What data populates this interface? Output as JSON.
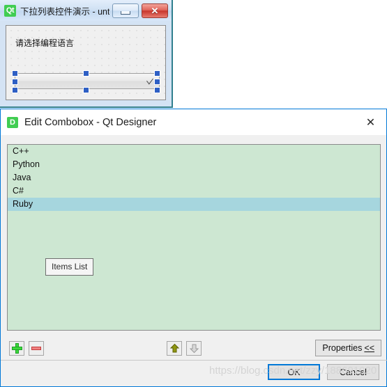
{
  "designer_form": {
    "title": "下拉列表控件演示 - unti...",
    "logo_text": "Qt",
    "logo_icon": "qt-logo-icon",
    "minimize_icon": "minimize-icon",
    "close_icon": "close-icon",
    "label_text": "请选择编程语言",
    "combobox_value": "",
    "combobox_arrow_icon": "chevron-down-icon"
  },
  "dialog": {
    "title": "Edit Combobox - Qt Designer",
    "icon_text": "D",
    "icon_name": "qt-designer-icon",
    "close_icon": "✕",
    "items": [
      {
        "label": "C++",
        "selected": false
      },
      {
        "label": "Python",
        "selected": false
      },
      {
        "label": "Java",
        "selected": false
      },
      {
        "label": "C#",
        "selected": false
      },
      {
        "label": "Ruby",
        "selected": true
      }
    ],
    "tooltip": "Items List",
    "toolbar": {
      "add_icon": "plus-icon",
      "remove_icon": "minus-icon",
      "move_up_icon": "arrow-up-icon",
      "move_down_icon": "arrow-down-icon",
      "properties_label": "Properties",
      "properties_chevrons": "<<"
    },
    "buttons": {
      "ok": "OK",
      "cancel": "Cancel"
    },
    "colors": {
      "list_background": "#cde7d2",
      "selection": "#a6d6de",
      "default_button_border": "#0078d7",
      "accent": "#41cd52"
    }
  },
  "watermark": {
    "line1": "https://blog.csdn.net/zzy/188691020"
  }
}
